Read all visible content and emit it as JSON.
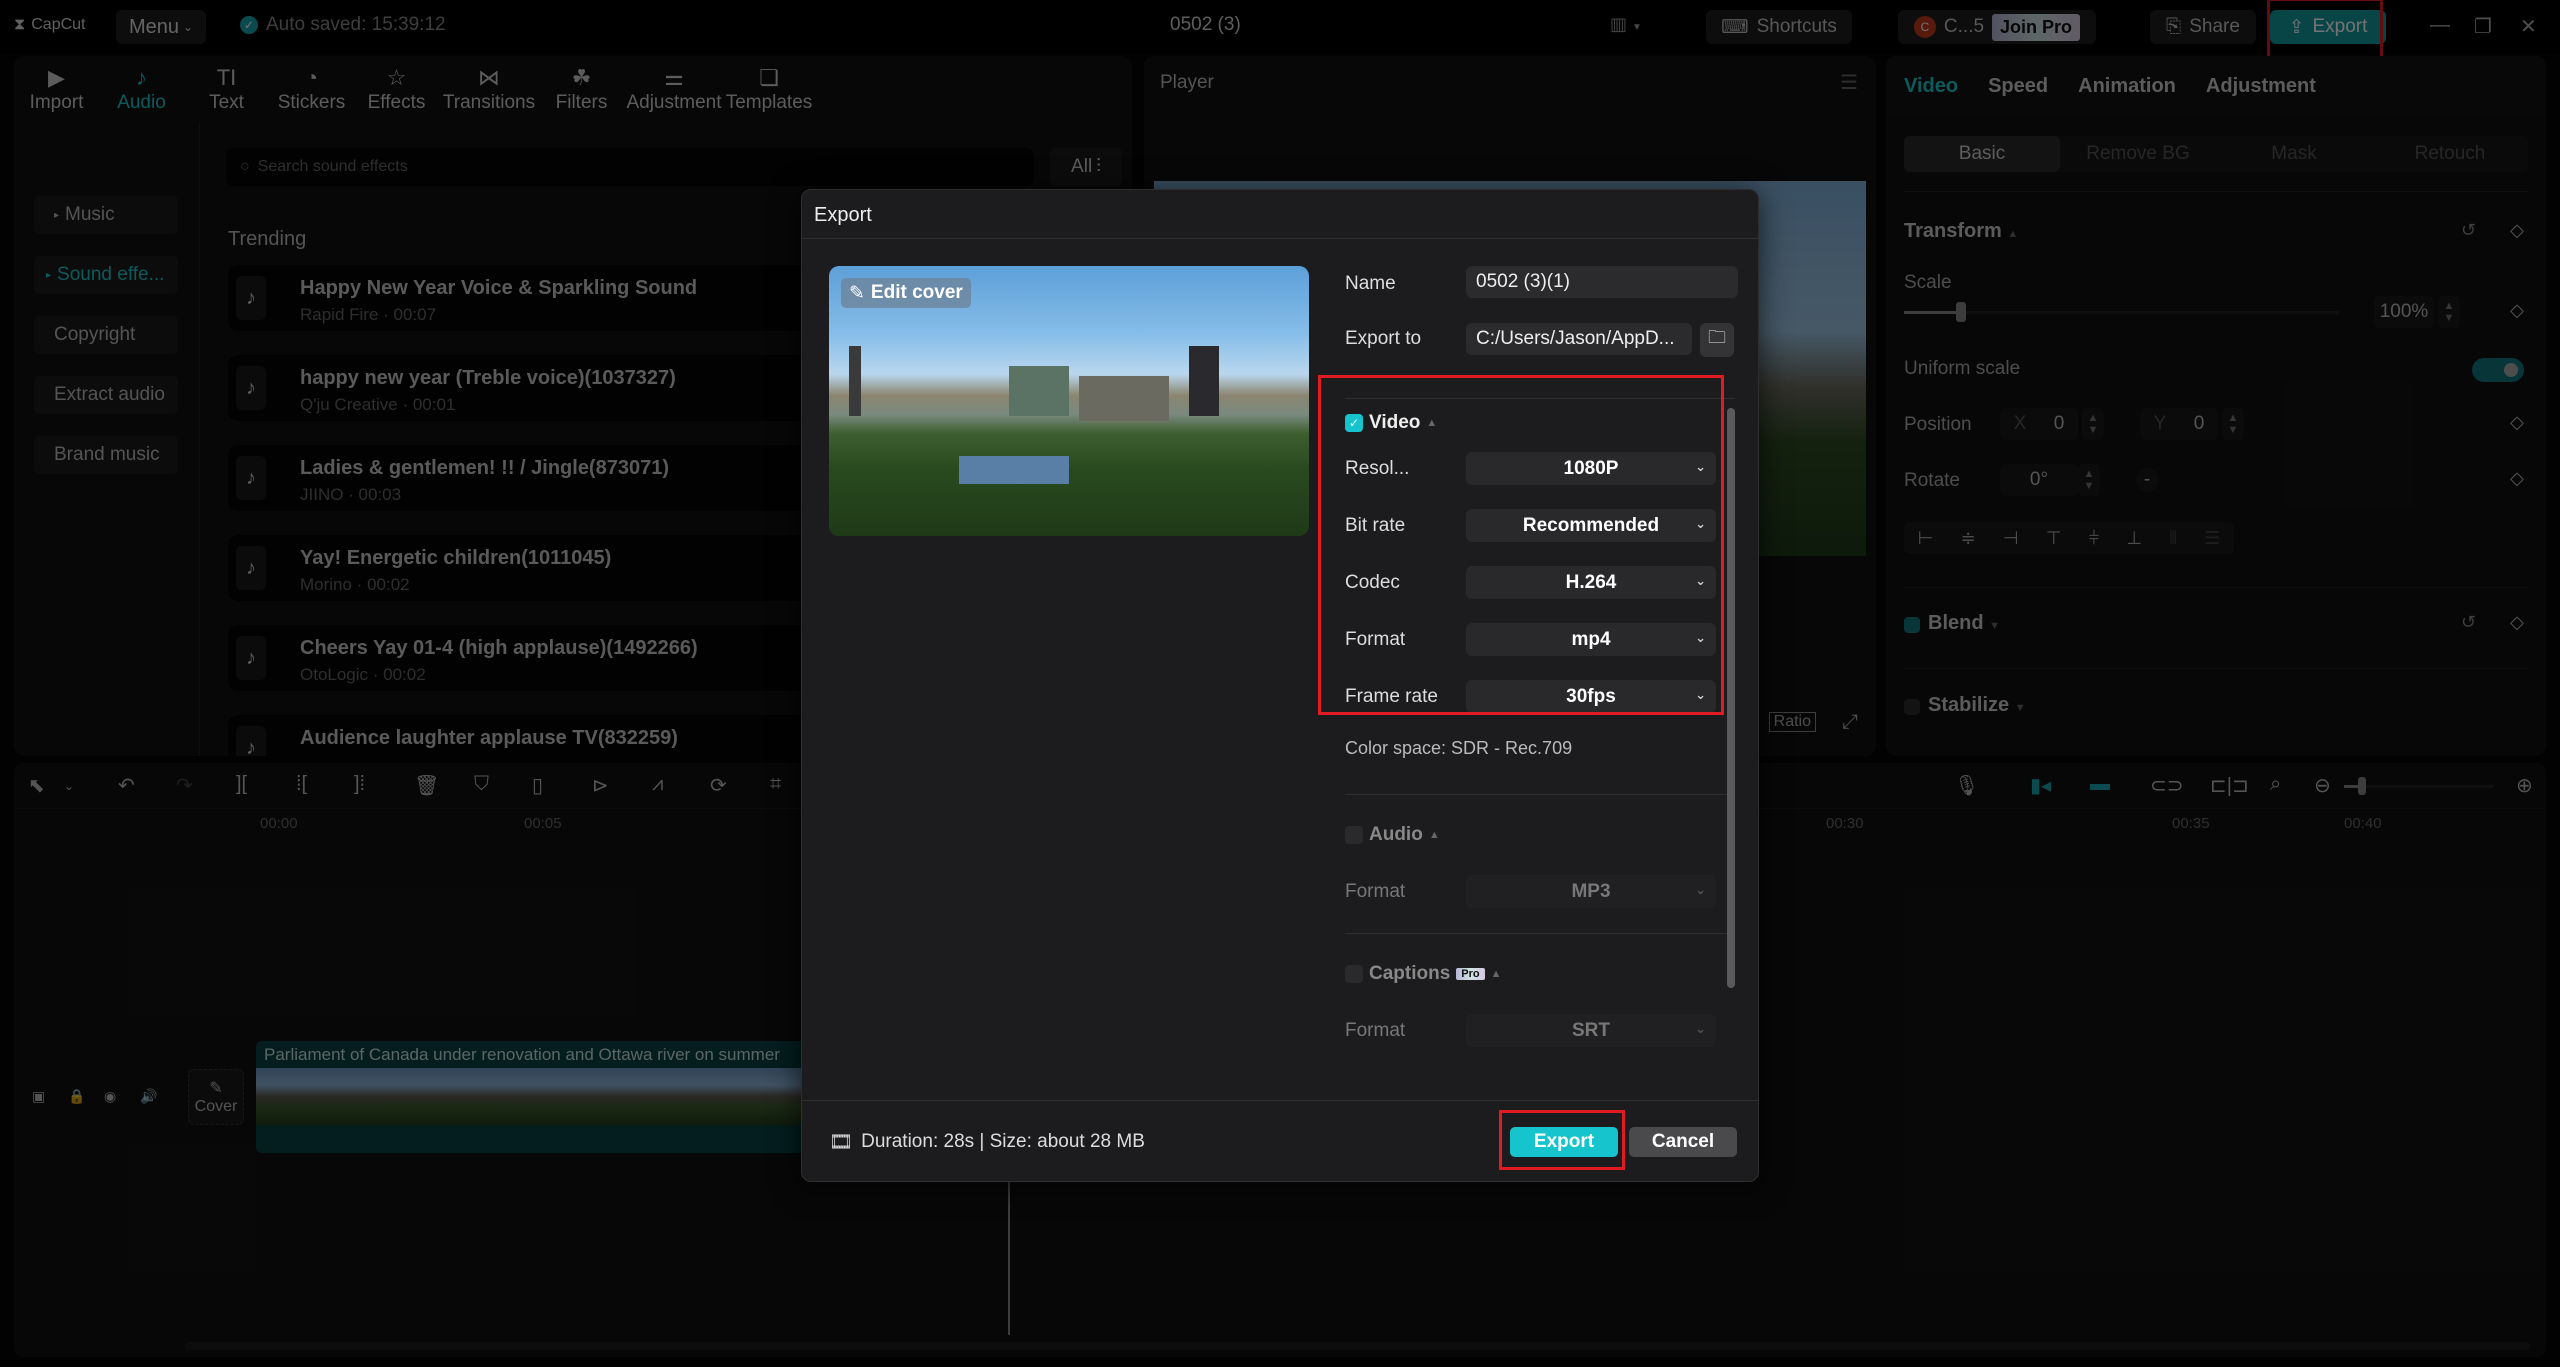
{
  "app": {
    "logo": "CapCut",
    "menu_label": "Menu",
    "auto_saved": "Auto saved: 15:39:12",
    "project_title": "0502 (3)",
    "shortcuts_label": "Shortcuts",
    "user_label": "C...5",
    "user_initial": "C",
    "join_pro_label": "Join Pro",
    "share_label": "Share",
    "export_label": "Export",
    "accent_color": "#1fc6cc"
  },
  "media": {
    "tools": [
      {
        "label": "Import",
        "icon": "import-icon"
      },
      {
        "label": "Audio",
        "icon": "audio-icon",
        "active": true
      },
      {
        "label": "Text",
        "icon": "text-icon"
      },
      {
        "label": "Stickers",
        "icon": "stickers-icon"
      },
      {
        "label": "Effects",
        "icon": "effects-icon"
      },
      {
        "label": "Transitions",
        "icon": "transitions-icon"
      },
      {
        "label": "Filters",
        "icon": "filters-icon"
      },
      {
        "label": "Adjustment",
        "icon": "adjustment-icon"
      },
      {
        "label": "Templates",
        "icon": "templates-icon"
      }
    ],
    "sidebar": [
      {
        "label": "Music"
      },
      {
        "label": "Sound effe...",
        "active": true
      },
      {
        "label": "Copyright"
      },
      {
        "label": "Extract audio"
      },
      {
        "label": "Brand music"
      }
    ],
    "search_placeholder": "Search sound effects",
    "filter_label": "All",
    "section_title": "Trending",
    "sounds": [
      {
        "name": "Happy New Year Voice & Sparkling Sound",
        "meta": "Rapid Fire · 00:07"
      },
      {
        "name": "happy new year (Treble voice)(1037327)",
        "meta": "Q'ju Creative · 00:01"
      },
      {
        "name": "Ladies & gentlemen! !! / Jingle(873071)",
        "meta": "JIINO · 00:03"
      },
      {
        "name": "Yay! Energetic children(1011045)",
        "meta": "Morino · 00:02"
      },
      {
        "name": "Cheers Yay 01-4 (high applause)(1492266)",
        "meta": "OtoLogic · 00:02"
      },
      {
        "name": "Audience laughter applause TV(832259)",
        "meta": ""
      }
    ]
  },
  "player": {
    "title": "Player",
    "ratio_label": "Ratio"
  },
  "properties": {
    "tabs": [
      "Video",
      "Speed",
      "Animation",
      "Adjustment"
    ],
    "subtabs": [
      "Basic",
      "Remove BG",
      "Mask",
      "Retouch"
    ],
    "transform_label": "Transform",
    "scale_label": "Scale",
    "scale_value": "100%",
    "scale_slider_fraction": 0.13,
    "uniform_scale_label": "Uniform scale",
    "uniform_scale_on": true,
    "position_label": "Position",
    "pos_x_label": "X",
    "pos_x": "0",
    "pos_y_label": "Y",
    "pos_y": "0",
    "rotate_label": "Rotate",
    "rotate_value": "0°",
    "blend_label": "Blend",
    "stabilize_label": "Stabilize"
  },
  "timeline": {
    "ruler": [
      "00:00",
      "00:05",
      "00:30",
      "00:35",
      "00:40"
    ],
    "clip_title": "Parliament of Canada under renovation and Ottawa river on summer",
    "cover_label": "Cover"
  },
  "export_dialog": {
    "title": "Export",
    "edit_cover_label": "Edit cover",
    "name_label": "Name",
    "name_value": "0502 (3)(1)",
    "export_to_label": "Export to",
    "export_to_value": "C:/Users/Jason/AppD...",
    "video": {
      "label": "Video",
      "checked": true,
      "resolution_label": "Resol...",
      "resolution": "1080P",
      "bitrate_label": "Bit rate",
      "bitrate": "Recommended",
      "codec_label": "Codec",
      "codec": "H.264",
      "format_label": "Format",
      "format": "mp4",
      "framerate_label": "Frame rate",
      "framerate": "30fps",
      "color_space": "Color space: SDR - Rec.709"
    },
    "audio": {
      "label": "Audio",
      "checked": false,
      "format_label": "Format",
      "format": "MP3"
    },
    "captions": {
      "label": "Captions",
      "pro_badge": "Pro",
      "checked": false,
      "format_label": "Format",
      "format": "SRT"
    },
    "info": "Duration: 28s | Size: about 28 MB",
    "export_button": "Export",
    "cancel_button": "Cancel"
  }
}
